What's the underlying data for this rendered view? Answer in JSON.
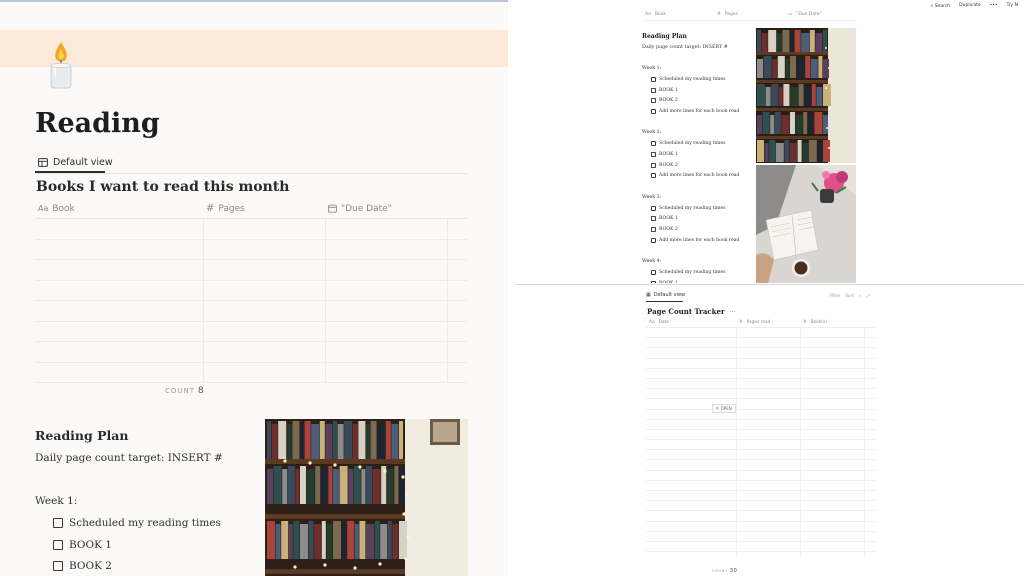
{
  "page": {
    "title": "Reading",
    "view_label": "Default view"
  },
  "books_db": {
    "title": "Books I want to read this month",
    "columns": [
      {
        "label": "Book",
        "icon": "text-property-icon"
      },
      {
        "label": "Pages",
        "icon": "hash-icon"
      },
      {
        "label": "\"Due Date\"",
        "icon": "calendar-icon"
      }
    ],
    "row_count": 8,
    "count_label": "COUNT",
    "count_value": "8"
  },
  "plan": {
    "heading": "Reading Plan",
    "target": "Daily page count target: INSERT #",
    "weeks": [
      {
        "label": "Week 1:",
        "items": [
          "Scheduled my reading times",
          "BOOK 1",
          "BOOK 2",
          "Add more lines for each book read"
        ]
      },
      {
        "label": "Week 2:",
        "items": [
          "Scheduled my reading times",
          "BOOK 1",
          "BOOK 2",
          "Add more lines for each book read"
        ]
      },
      {
        "label": "Week 3:",
        "items": [
          "Scheduled my reading times",
          "BOOK 1",
          "BOOK 2",
          "Add more lines for each book read"
        ]
      },
      {
        "label": "Week 4:",
        "items": [
          "Scheduled my reading times",
          "BOOK 1"
        ]
      }
    ]
  },
  "topbar": {
    "search": "Search",
    "duplicate": "Duplicate",
    "more": "•••",
    "try": "Try N"
  },
  "tracker": {
    "view_label": "Default view",
    "tools": [
      "Filter",
      "Sort"
    ],
    "title": "Page Count Tracker",
    "title_more": "···",
    "columns": [
      {
        "label": "Date",
        "icon": "text-property-icon"
      },
      {
        "label": "Pages read",
        "icon": "hash-icon"
      },
      {
        "label": "Book(s)",
        "icon": "hash-icon"
      }
    ],
    "row_count": 22,
    "open_label": "OPEN",
    "count_label": "COUNT",
    "count_value": "30"
  },
  "colors": {
    "cover": "#fbe9da",
    "flame": "#f5a623",
    "text": "#2f2f2f",
    "muted": "#8b8a86"
  }
}
